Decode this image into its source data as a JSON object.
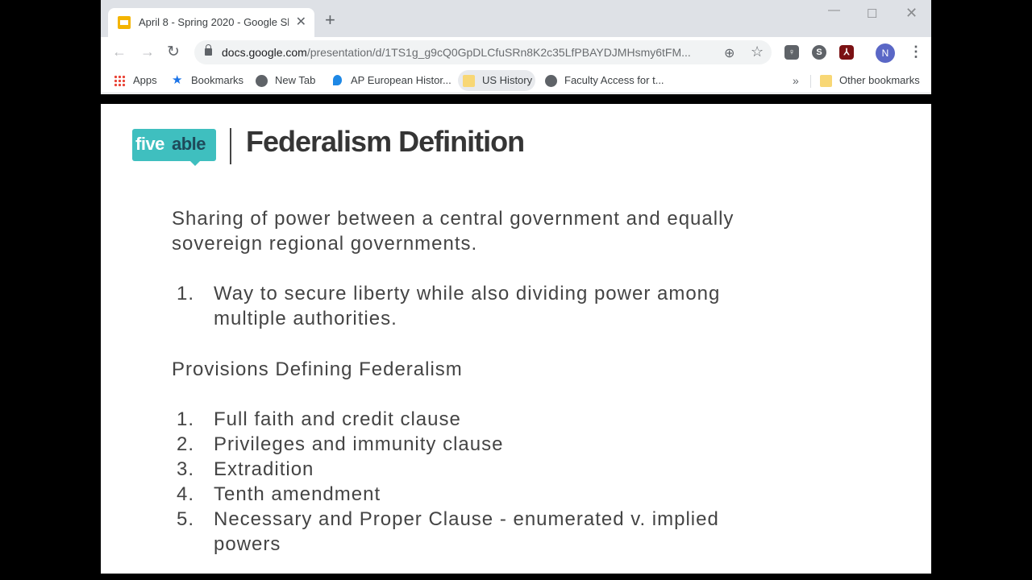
{
  "tab": {
    "title": "April 8 - Spring 2020 - Google Sl",
    "close": "✕",
    "new_tab": "+"
  },
  "window_controls": {
    "minimize": "—",
    "maximize": "☐",
    "close": "✕"
  },
  "toolbar": {
    "back": "←",
    "forward": "→",
    "reload": "↻",
    "url_host": "docs.google.com",
    "url_path": "/presentation/d/1TS1g_g9cQ0GpDLCfuSRn8K2c35LfPBAYDJMHsmy6tFM...",
    "zoom_icon": "⊕",
    "star_icon": "☆",
    "extensions": [
      "♀",
      "S",
      "⅄"
    ],
    "avatar_initial": "N",
    "menu_icon": "⋮"
  },
  "bookmarks": {
    "apps": "Apps",
    "bookmarks": "Bookmarks",
    "new_tab": "New Tab",
    "ap_european": "AP European Histor...",
    "us_history": "US History",
    "faculty": "Faculty Access for t...",
    "more": "»",
    "other": "Other bookmarks"
  },
  "slide": {
    "logo_five": "five",
    "logo_able": "able",
    "title": "Federalism Definition",
    "definition_line1": "Sharing of power between a central government and equally",
    "definition_line2": "sovereign regional governments.",
    "definition_items": [
      {
        "num": "1.",
        "line1": "Way to secure liberty while also dividing power among",
        "line2": "multiple authorities."
      }
    ],
    "provisions_heading": "Provisions Defining Federalism",
    "provisions": [
      {
        "num": "1.",
        "text": "Full faith and credit clause"
      },
      {
        "num": "2.",
        "text": "Privileges and immunity clause"
      },
      {
        "num": "3.",
        "text": "Extradition"
      },
      {
        "num": "4.",
        "text": "Tenth amendment"
      },
      {
        "num": "5.",
        "text": "Necessary and Proper Clause - enumerated v. implied",
        "line2": "powers"
      }
    ]
  }
}
